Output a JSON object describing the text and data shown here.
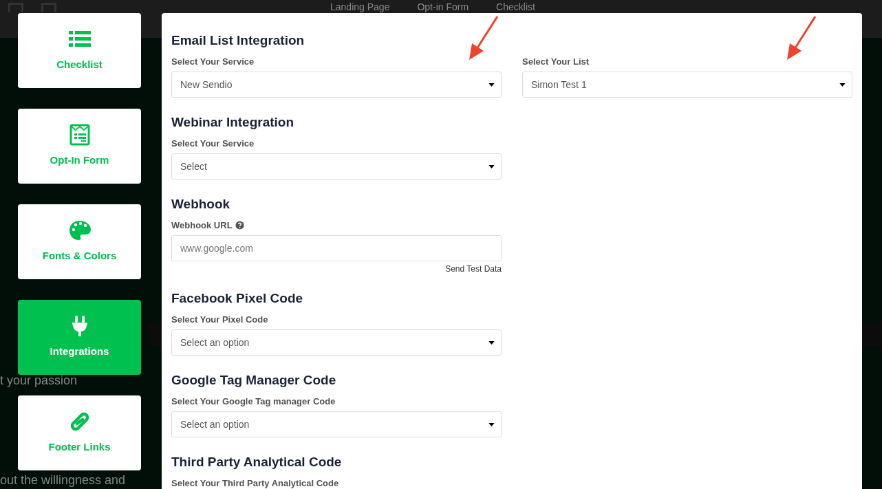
{
  "background": {
    "nav": [
      "Landing Page",
      "Opt-in Form",
      "Checklist"
    ],
    "texts": [
      "t your passion",
      "out the willingness and"
    ]
  },
  "sidebar": {
    "items": [
      {
        "label": "Checklist",
        "kind": "list",
        "selected": false
      },
      {
        "label": "Opt-In Form",
        "kind": "form",
        "selected": false
      },
      {
        "label": "Fonts & Colors",
        "kind": "palette",
        "selected": false
      },
      {
        "label": "Integrations",
        "kind": "plug",
        "selected": true
      },
      {
        "label": "Footer Links",
        "kind": "link",
        "selected": false
      }
    ]
  },
  "sections": [
    {
      "title": "Email List Integration",
      "fields": [
        {
          "kind": "select",
          "label": "Select Your Service",
          "value": "New Sendio",
          "annotated": true
        },
        {
          "kind": "select",
          "label": "Select Your List",
          "value": "Simon Test 1",
          "annotated": true
        }
      ]
    },
    {
      "title": "Webinar Integration",
      "fields": [
        {
          "kind": "select",
          "label": "Select Your Service",
          "value": "Select"
        }
      ]
    },
    {
      "title": "Webhook",
      "fields": [
        {
          "kind": "input",
          "label": "Webhook URL",
          "help": true,
          "placeholder": "www.google.com",
          "action": "Send Test Data"
        }
      ]
    },
    {
      "title": "Facebook Pixel Code",
      "fields": [
        {
          "kind": "select",
          "label": "Select Your Pixel Code",
          "value": "Select an option"
        }
      ]
    },
    {
      "title": "Google Tag Manager Code",
      "fields": [
        {
          "kind": "select",
          "label": "Select Your Google Tag manager Code",
          "value": "Select an option"
        }
      ]
    },
    {
      "title": "Third Party Analytical Code",
      "fields": [
        {
          "kind": "label-only",
          "label": "Select Your Third Party Analytical Code"
        }
      ]
    }
  ]
}
